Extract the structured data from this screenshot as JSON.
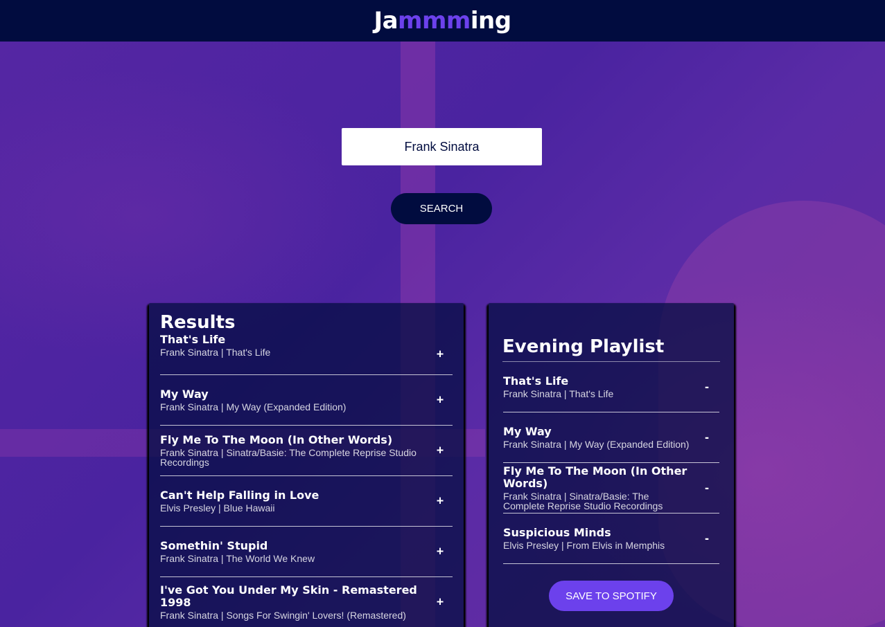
{
  "app": {
    "logo_prefix": "Ja",
    "logo_highlight": "mmm",
    "logo_suffix": "ing"
  },
  "search": {
    "value": "Frank Sinatra",
    "button_label": "SEARCH"
  },
  "results": {
    "title": "Results",
    "action_symbol": "+",
    "tracks": [
      {
        "name": "That's Life",
        "meta": "Frank Sinatra | That's Life"
      },
      {
        "name": "My Way",
        "meta": "Frank Sinatra | My Way (Expanded Edition)"
      },
      {
        "name": "Fly Me To The Moon (In Other Words)",
        "meta": "Frank Sinatra | Sinatra/Basie: The Complete Reprise Studio Recordings"
      },
      {
        "name": "Can't Help Falling in Love",
        "meta": "Elvis Presley | Blue Hawaii"
      },
      {
        "name": "Somethin' Stupid",
        "meta": "Frank Sinatra | The World We Knew"
      },
      {
        "name": "I've Got You Under My Skin - Remastered 1998",
        "meta": "Frank Sinatra | Songs For Swingin' Lovers! (Remastered)"
      }
    ]
  },
  "playlist": {
    "name": "Evening Playlist",
    "action_symbol": "-",
    "save_label": "SAVE TO SPOTIFY",
    "tracks": [
      {
        "name": "That's Life",
        "meta": "Frank Sinatra | That's Life"
      },
      {
        "name": "My Way",
        "meta": "Frank Sinatra | My Way (Expanded Edition)"
      },
      {
        "name": "Fly Me To The Moon (In Other Words)",
        "meta": "Frank Sinatra | Sinatra/Basie: The Complete Reprise Studio Recordings"
      },
      {
        "name": "Suspicious Minds",
        "meta": "Elvis Presley | From Elvis in Memphis"
      }
    ]
  },
  "colors": {
    "header_bg": "#010c3f",
    "accent": "#6c41ec",
    "panel_bg": "#010c3f"
  }
}
